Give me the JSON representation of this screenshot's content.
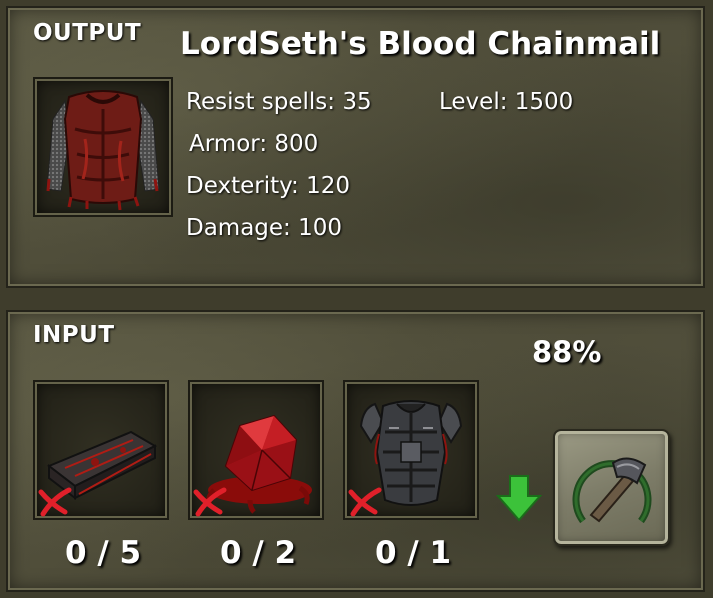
{
  "output": {
    "title": "OUTPUT",
    "item_name": "LordSeth's Blood Chainmail",
    "icon": "blood-chainmail-icon",
    "stats": {
      "resist_spells": "Resist spells: 35",
      "level": "Level: 1500",
      "armor": "Armor: 800",
      "dexterity": "Dexterity: 120",
      "damage": "Damage: 100"
    }
  },
  "input": {
    "title": "INPUT",
    "success_chance": "88%",
    "ingredients": [
      {
        "icon": "blood-ingot-icon",
        "count": "0 / 5",
        "have": 0,
        "need": 5
      },
      {
        "icon": "blood-gem-icon",
        "count": "0 / 2",
        "have": 0,
        "need": 2
      },
      {
        "icon": "dark-chest-armor-icon",
        "count": "0 / 1",
        "have": 0,
        "need": 1
      }
    ],
    "craft_button_icon": "hammer-icon",
    "down_arrow_color": "#3cc23a",
    "missing_mark_color": "#e0202a"
  }
}
